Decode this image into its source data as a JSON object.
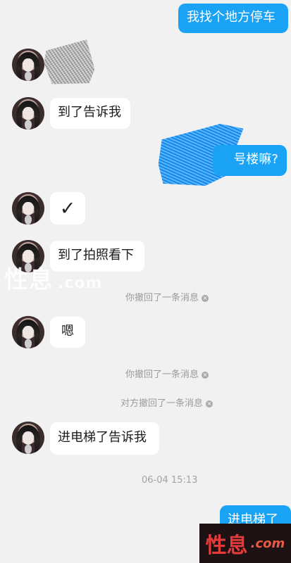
{
  "messages": {
    "m1": "我找个地方停车",
    "m2": "到了告诉我",
    "m3": "号楼嘛?",
    "m4": "✓",
    "m5": "到了拍照看下",
    "m6": "嗯",
    "m7": "进电梯了告诉我",
    "m8": "进电梯了"
  },
  "notices": {
    "n1": "你撤回了一条消息",
    "n2": "你撤回了一条消息",
    "n3": "对方撤回了一条消息"
  },
  "timestamp": "06-04 15:13",
  "watermark": {
    "char": "性息",
    "domain": ".com"
  }
}
